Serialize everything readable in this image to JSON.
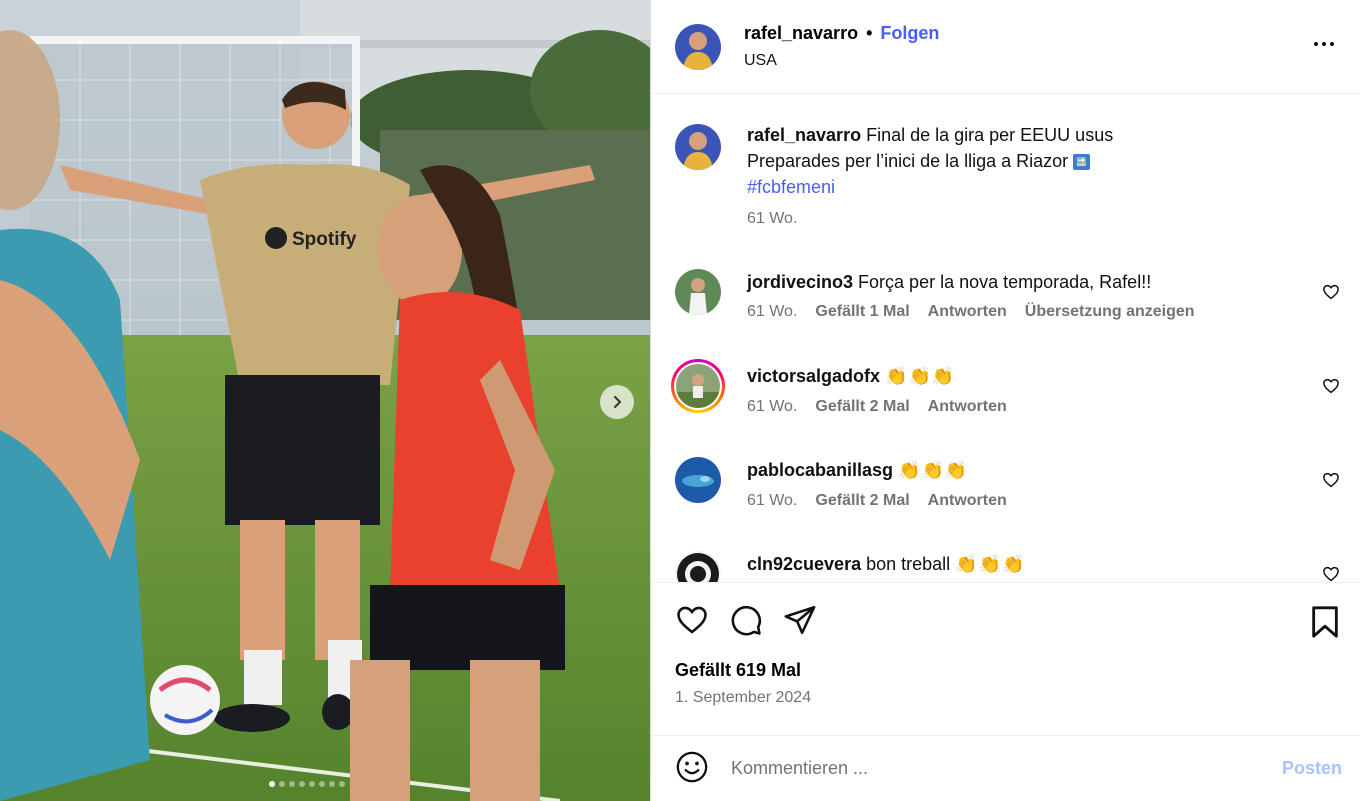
{
  "media": {
    "next_icon": "chevron-right-icon",
    "slide_count": 8,
    "active_slide": 1,
    "shirt_text": "Spotify"
  },
  "header": {
    "username": "rafel_navarro",
    "separator": "•",
    "follow_label": "Folgen",
    "location": "USA",
    "more_icon": "more-options-icon"
  },
  "caption": {
    "username": "rafel_navarro",
    "text_line1": "Final de la gira per EEUU usus",
    "text_line2": "Preparades per l’inici de la lliga a Riazor",
    "soon_icon": "🔜",
    "hashtag": "#fcbfemeni",
    "time": "61 Wo."
  },
  "comments": [
    {
      "username": "jordivecino3",
      "text": "Força per la nova temporada, Rafel!!",
      "time": "61 Wo.",
      "likes": "Gefällt 1 Mal",
      "reply": "Antworten",
      "translate": "Übersetzung anzeigen"
    },
    {
      "username": "victorsalgadofx",
      "text": "👏👏👏",
      "time": "61 Wo.",
      "likes": "Gefällt 2 Mal",
      "reply": "Antworten"
    },
    {
      "username": "pablocabanillasg",
      "text": "👏👏👏",
      "time": "61 Wo.",
      "likes": "Gefällt 2 Mal",
      "reply": "Antworten"
    },
    {
      "username": "cln92cuevera",
      "text": "bon treball",
      "emoji": "👏👏👏"
    }
  ],
  "actions": {
    "like_icon": "heart-icon",
    "comment_icon": "comment-icon",
    "share_icon": "send-icon",
    "save_icon": "bookmark-icon"
  },
  "likes_label": "Gefällt 619 Mal",
  "date": "1. September 2024",
  "add_comment": {
    "emoji_icon": "smiley-icon",
    "placeholder": "Kommentieren ...",
    "post_label": "Posten"
  },
  "colors": {
    "link_blue": "#4a5df9",
    "post_disabled": "#a7c2ff",
    "muted": "#737373"
  }
}
